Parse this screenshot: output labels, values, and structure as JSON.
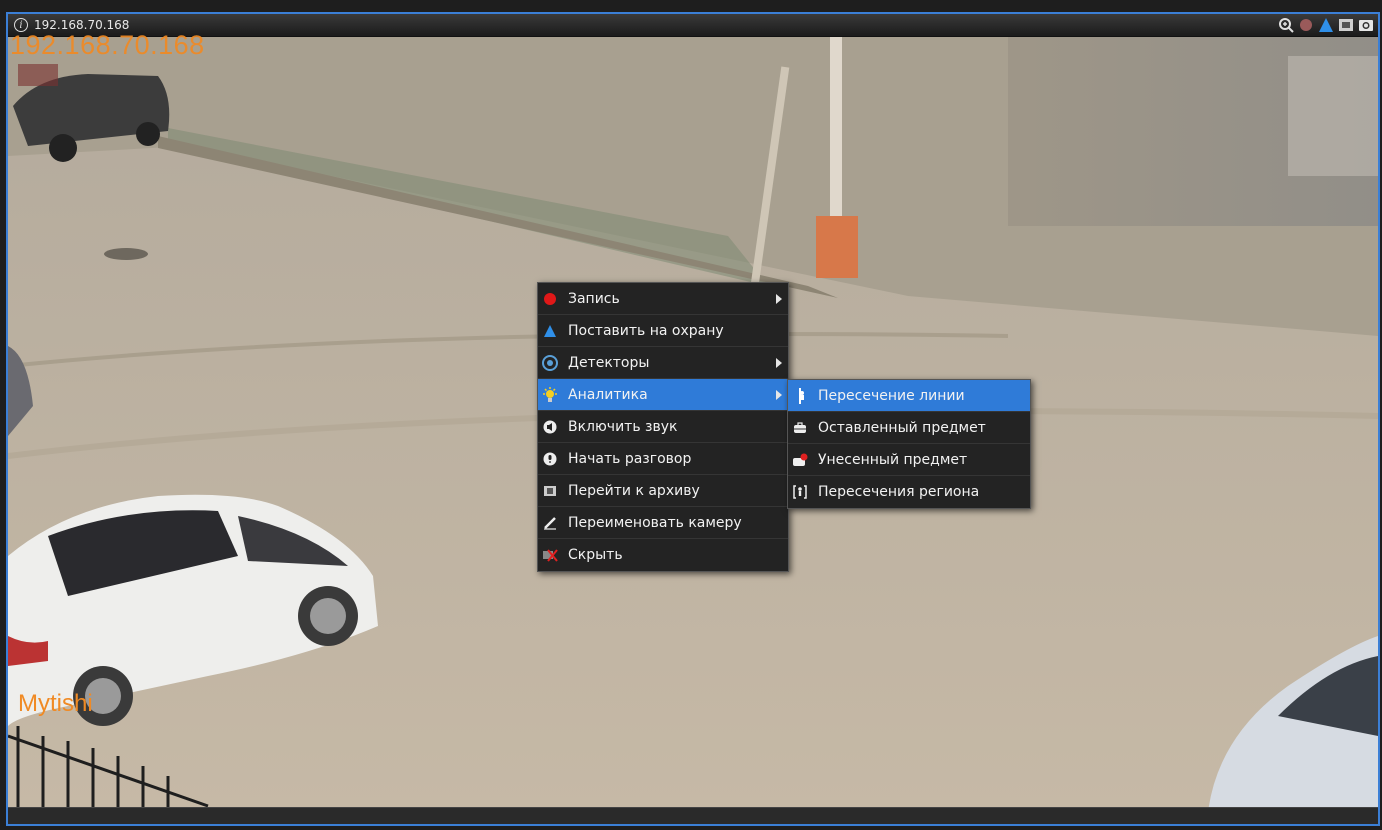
{
  "window": {
    "title_ip": "192.168.70.168",
    "accent_color": "#3b7fd6"
  },
  "toolbar_icons": [
    "zoom-icon",
    "record-status-icon",
    "arm-icon",
    "archive-icon",
    "snapshot-icon"
  ],
  "osd": {
    "ip_text": "192.168.70.168",
    "location_text": "Mytishi",
    "color": "#f08a24"
  },
  "context_menu": {
    "items": [
      {
        "label": "Запись",
        "icon": "record-icon",
        "has_submenu": true
      },
      {
        "label": "Поставить на охрану",
        "icon": "arm-icon",
        "has_submenu": false
      },
      {
        "label": "Детекторы",
        "icon": "detectors-icon",
        "has_submenu": true
      },
      {
        "label": "Аналитика",
        "icon": "analytics-icon",
        "has_submenu": true,
        "active": true
      },
      {
        "label": "Включить звук",
        "icon": "sound-icon",
        "has_submenu": false
      },
      {
        "label": "Начать разговор",
        "icon": "microphone-icon",
        "has_submenu": false
      },
      {
        "label": "Перейти к архиву",
        "icon": "archive-icon",
        "has_submenu": false
      },
      {
        "label": "Переименовать камеру",
        "icon": "rename-icon",
        "has_submenu": false
      },
      {
        "label": "Скрыть",
        "icon": "hide-icon",
        "has_submenu": false
      }
    ]
  },
  "analytics_submenu": {
    "items": [
      {
        "label": "Пересечение линии",
        "icon": "line-crossing-icon",
        "active": true
      },
      {
        "label": "Оставленный предмет",
        "icon": "left-object-icon"
      },
      {
        "label": "Унесенный предмет",
        "icon": "removed-object-icon"
      },
      {
        "label": "Пересечения региона",
        "icon": "region-crossing-icon"
      }
    ]
  }
}
